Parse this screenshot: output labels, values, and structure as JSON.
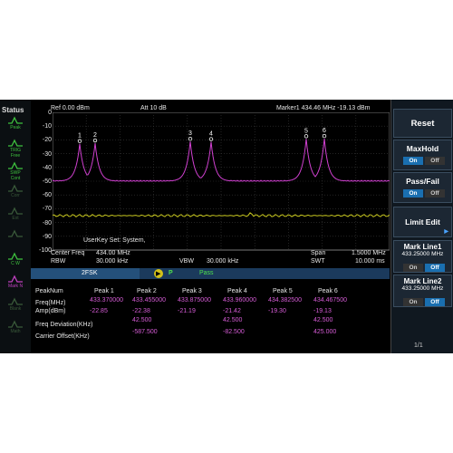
{
  "status": {
    "title": "Status",
    "items": [
      {
        "label": "Peak",
        "icon": "peak-icon",
        "color": "#3ec23e"
      },
      {
        "label": "TRIG\nFree",
        "icon": "trig-icon",
        "color": "#3ec23e"
      },
      {
        "label": "SWP\nCont",
        "icon": "sweep-icon",
        "color": "#3ec23e"
      },
      {
        "label": "Corr",
        "icon": "corr-icon",
        "color": "#3a5a3a"
      },
      {
        "label": "Ext",
        "icon": "ext-icon",
        "color": "#3a5a3a"
      },
      {
        "label": "",
        "icon": "trace-icon",
        "color": "#3a5a3a"
      },
      {
        "label": "C W",
        "icon": "cw-icon",
        "color": "#3ec23e"
      },
      {
        "label": "Mark N",
        "icon": "marker-icon",
        "color": "#c040c0"
      },
      {
        "label": "Blank",
        "icon": "blank-icon",
        "color": "#3a5a3a"
      },
      {
        "label": "Math",
        "icon": "math-icon",
        "color": "#3a5a3a"
      }
    ]
  },
  "topbar": {
    "ref": "Ref  0.00 dBm",
    "att": "Att    10 dB",
    "marker": "Marker1   434.46 MHz   -19.13 dBm"
  },
  "y_ticks": [
    "0",
    "-10",
    "-20",
    "-30",
    "-40",
    "-50",
    "-60",
    "-70",
    "-80",
    "-90",
    "-100"
  ],
  "user_key": "UserKey Set:   System,",
  "freq_info": {
    "center_label": "Center Freq",
    "center_value": "434.00 MHz",
    "rbw_label": "RBW",
    "rbw_value": "30.000 kHz",
    "vbw_label": "VBW",
    "vbw_value": "30.000 kHz",
    "span_label": "Span",
    "span_value": "1.5000 MHz",
    "swt_label": "SWT",
    "swt_value": "10.000 ms"
  },
  "fsk": {
    "tab": "2FSK",
    "p": "P",
    "result": "Pass"
  },
  "table": {
    "row_label_header": "PeakNum",
    "headers": [
      "Peak 1",
      "Peak 2",
      "Peak 3",
      "Peak 4",
      "Peak 5",
      "Peak 6"
    ],
    "rows": [
      {
        "label": "Freq(MHz)",
        "values": [
          "433.370000",
          "433.455000",
          "433.875000",
          "433.960000",
          "434.382500",
          "434.467500"
        ]
      },
      {
        "label": "Amp(dBm)",
        "values": [
          "-22.85",
          "-22.38",
          "-21.19",
          "-21.42",
          "-19.30",
          "-19.13"
        ]
      },
      {
        "label": "Freq Deviation(KHz)",
        "values": [
          "",
          "42.500",
          "",
          "42.500",
          "",
          "42.500"
        ]
      },
      {
        "label": "Carrier Offset(KHz)",
        "values": [
          "",
          "-587.500",
          "",
          "-82.500",
          "",
          "425.000"
        ]
      }
    ]
  },
  "softkeys": {
    "reset": "Reset",
    "maxhold": "MaxHold",
    "passfail": "Pass/Fail",
    "limit_edit": "Limit Edit",
    "markline1": "Mark Line1",
    "markline1_value": "433.25000 MHz",
    "markline2": "Mark Line2",
    "markline2_value": "433.25000 MHz",
    "on": "On",
    "off": "Off",
    "page": "1/1"
  },
  "markers": [
    "1",
    "2",
    "3",
    "4",
    "5",
    "6"
  ],
  "colors": {
    "trace": "#d040d0",
    "limit": "#c8c820",
    "grid": "#3a3a3a",
    "accent": "#1a6fb0"
  }
}
